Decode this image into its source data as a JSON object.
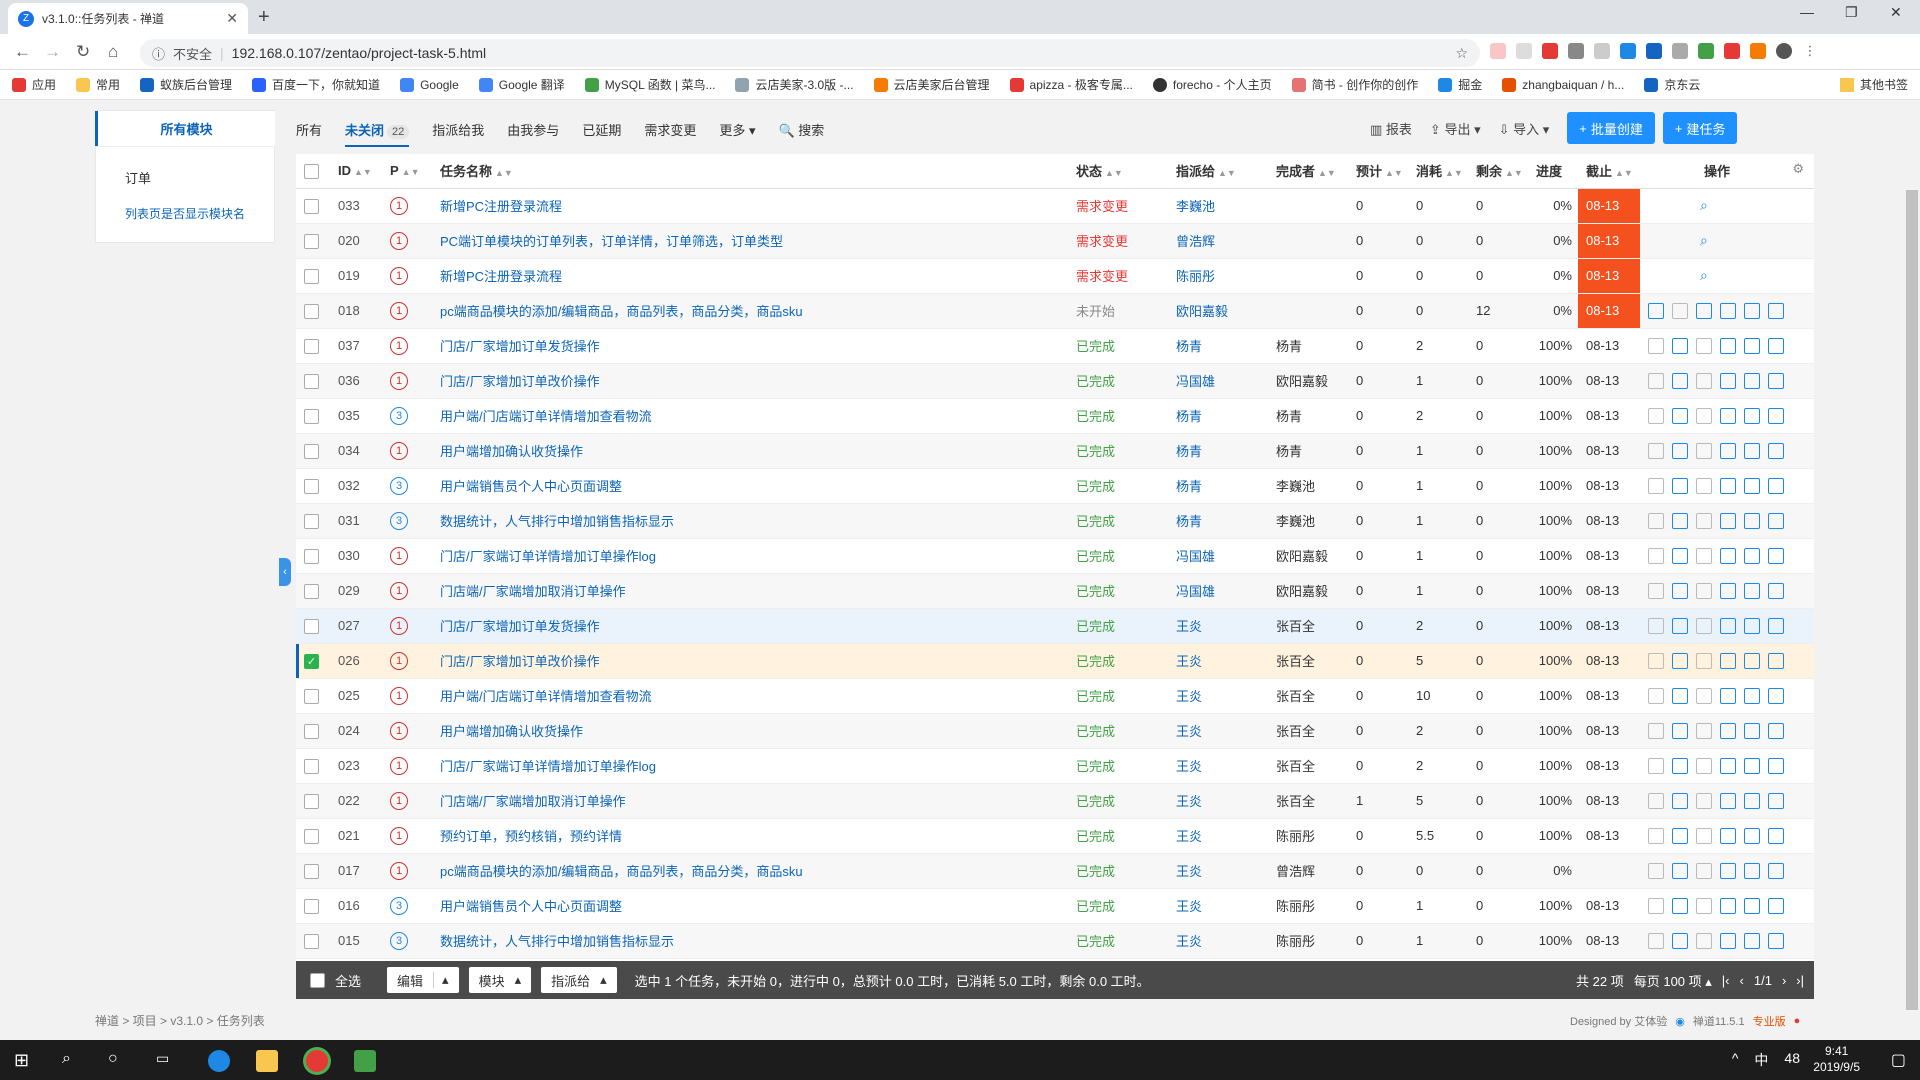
{
  "browser": {
    "tab_title": "v3.1.0::任务列表 - 禅道",
    "insecure": "不安全",
    "url": "192.168.0.107/zentao/project-task-5.html"
  },
  "bookmarks": [
    "应用",
    "常用",
    "蚁族后台管理",
    "百度一下，你就知道",
    "Google",
    "Google 翻译",
    "MySQL 函数 | 菜鸟...",
    "云店美家-3.0版 -...",
    "云店美家后台管理",
    "apizza - 极客专属...",
    "forecho - 个人主页",
    "简书 - 创作你的创作",
    "掘金",
    "zhangbaiquan / h...",
    "京东云"
  ],
  "bookmarks_other": "其他书签",
  "sidebar": {
    "title": "所有模块",
    "item": "订单",
    "link": "列表页是否显示模块名"
  },
  "filters": [
    {
      "label": "所有"
    },
    {
      "label": "未关闭",
      "count": "22"
    },
    {
      "label": "指派给我"
    },
    {
      "label": "由我参与"
    },
    {
      "label": "已延期"
    },
    {
      "label": "需求变更"
    },
    {
      "label": "更多 ▾"
    },
    {
      "label": "🔍 搜索"
    }
  ],
  "toolbar": {
    "report": "报表",
    "export": "导出",
    "import": "导入",
    "batch_create": "批量创建",
    "create": "建任务"
  },
  "columns": {
    "id": "ID",
    "p": "P",
    "name": "任务名称",
    "status": "状态",
    "assigned": "指派给",
    "finished": "完成者",
    "estimate": "预计",
    "consumed": "消耗",
    "left": "剩余",
    "progress": "进度",
    "deadline": "截止",
    "actions": "操作"
  },
  "rows": [
    {
      "id": "033",
      "p": "1",
      "name": "新增PC注册登录流程",
      "status": "需求变更",
      "st": "red",
      "assigned": "李巍池",
      "finished": "",
      "est": "0",
      "con": "0",
      "left": "0",
      "prog": "0%",
      "deadline": "08-13",
      "late": true,
      "mode": "search"
    },
    {
      "id": "020",
      "p": "1",
      "name": "PC端订单模块的订单列表，订单详情，订单筛选，订单类型",
      "status": "需求变更",
      "st": "red",
      "assigned": "曾浩辉",
      "finished": "",
      "est": "0",
      "con": "0",
      "left": "0",
      "prog": "0%",
      "deadline": "08-13",
      "late": true,
      "mode": "search"
    },
    {
      "id": "019",
      "p": "1",
      "name": "新增PC注册登录流程",
      "status": "需求变更",
      "st": "red",
      "assigned": "陈丽彤",
      "finished": "",
      "est": "0",
      "con": "0",
      "left": "0",
      "prog": "0%",
      "deadline": "08-13",
      "late": true,
      "mode": "search"
    },
    {
      "id": "018",
      "p": "1",
      "name": "pc端商品模块的添加/编辑商品，商品列表，商品分类，商品sku",
      "status": "未开始",
      "st": "grey",
      "assigned": "欧阳嘉毅",
      "finished": "",
      "est": "0",
      "con": "0",
      "left": "12",
      "prog": "0%",
      "deadline": "08-13",
      "late": true,
      "mode": "full"
    },
    {
      "id": "037",
      "p": "1",
      "name": "门店/厂家增加订单发货操作",
      "status": "已完成",
      "st": "green",
      "assigned": "杨青",
      "finished": "杨青",
      "est": "0",
      "con": "2",
      "left": "0",
      "prog": "100%",
      "deadline": "08-13",
      "mode": "done"
    },
    {
      "id": "036",
      "p": "1",
      "name": "门店/厂家增加订单改价操作",
      "status": "已完成",
      "st": "green",
      "assigned": "冯国雄",
      "finished": "欧阳嘉毅",
      "est": "0",
      "con": "1",
      "left": "0",
      "prog": "100%",
      "deadline": "08-13",
      "mode": "done"
    },
    {
      "id": "035",
      "p": "3",
      "name": "用户端/门店端订单详情增加查看物流",
      "status": "已完成",
      "st": "green",
      "assigned": "杨青",
      "finished": "杨青",
      "est": "0",
      "con": "2",
      "left": "0",
      "prog": "100%",
      "deadline": "08-13",
      "mode": "done"
    },
    {
      "id": "034",
      "p": "1",
      "name": "用户端增加确认收货操作",
      "status": "已完成",
      "st": "green",
      "assigned": "杨青",
      "finished": "杨青",
      "est": "0",
      "con": "1",
      "left": "0",
      "prog": "100%",
      "deadline": "08-13",
      "mode": "done"
    },
    {
      "id": "032",
      "p": "3",
      "name": "用户端销售员个人中心页面调整",
      "status": "已完成",
      "st": "green",
      "assigned": "杨青",
      "finished": "李巍池",
      "est": "0",
      "con": "1",
      "left": "0",
      "prog": "100%",
      "deadline": "08-13",
      "mode": "done"
    },
    {
      "id": "031",
      "p": "3",
      "name": "数据统计，人气排行中增加销售指标显示",
      "status": "已完成",
      "st": "green",
      "assigned": "杨青",
      "finished": "李巍池",
      "est": "0",
      "con": "1",
      "left": "0",
      "prog": "100%",
      "deadline": "08-13",
      "mode": "done"
    },
    {
      "id": "030",
      "p": "1",
      "name": "门店/厂家端订单详情增加订单操作log",
      "status": "已完成",
      "st": "green",
      "assigned": "冯国雄",
      "finished": "欧阳嘉毅",
      "est": "0",
      "con": "1",
      "left": "0",
      "prog": "100%",
      "deadline": "08-13",
      "mode": "done"
    },
    {
      "id": "029",
      "p": "1",
      "name": "门店端/厂家端增加取消订单操作",
      "status": "已完成",
      "st": "green",
      "assigned": "冯国雄",
      "finished": "欧阳嘉毅",
      "est": "0",
      "con": "1",
      "left": "0",
      "prog": "100%",
      "deadline": "08-13",
      "mode": "done"
    },
    {
      "id": "027",
      "p": "1",
      "name": "门店/厂家增加订单发货操作",
      "status": "已完成",
      "st": "green",
      "assigned": "王炎",
      "finished": "张百全",
      "est": "0",
      "con": "2",
      "left": "0",
      "prog": "100%",
      "deadline": "08-13",
      "mode": "done",
      "hover": true
    },
    {
      "id": "026",
      "p": "1",
      "name": "门店/厂家增加订单改价操作",
      "status": "已完成",
      "st": "green",
      "assigned": "王炎",
      "finished": "张百全",
      "est": "0",
      "con": "5",
      "left": "0",
      "prog": "100%",
      "deadline": "08-13",
      "mode": "done",
      "selected": true
    },
    {
      "id": "025",
      "p": "1",
      "name": "用户端/门店端订单详情增加查看物流",
      "status": "已完成",
      "st": "green",
      "assigned": "王炎",
      "finished": "张百全",
      "est": "0",
      "con": "10",
      "left": "0",
      "prog": "100%",
      "deadline": "08-13",
      "mode": "done"
    },
    {
      "id": "024",
      "p": "1",
      "name": "用户端增加确认收货操作",
      "status": "已完成",
      "st": "green",
      "assigned": "王炎",
      "finished": "张百全",
      "est": "0",
      "con": "2",
      "left": "0",
      "prog": "100%",
      "deadline": "08-13",
      "mode": "done"
    },
    {
      "id": "023",
      "p": "1",
      "name": "门店/厂家端订单详情增加订单操作log",
      "status": "已完成",
      "st": "green",
      "assigned": "王炎",
      "finished": "张百全",
      "est": "0",
      "con": "2",
      "left": "0",
      "prog": "100%",
      "deadline": "08-13",
      "mode": "done"
    },
    {
      "id": "022",
      "p": "1",
      "name": "门店端/厂家端增加取消订单操作",
      "status": "已完成",
      "st": "green",
      "assigned": "王炎",
      "finished": "张百全",
      "est": "1",
      "con": "5",
      "left": "0",
      "prog": "100%",
      "deadline": "08-13",
      "mode": "done"
    },
    {
      "id": "021",
      "p": "1",
      "name": "预约订单，预约核销，预约详情",
      "status": "已完成",
      "st": "green",
      "assigned": "王炎",
      "finished": "陈丽彤",
      "est": "0",
      "con": "5.5",
      "left": "0",
      "prog": "100%",
      "deadline": "08-13",
      "mode": "done"
    },
    {
      "id": "017",
      "p": "1",
      "name": "pc端商品模块的添加/编辑商品，商品列表，商品分类，商品sku",
      "status": "已完成",
      "st": "green",
      "assigned": "王炎",
      "finished": "曾浩辉",
      "est": "0",
      "con": "0",
      "left": "0",
      "prog": "0%",
      "deadline": "",
      "mode": "done"
    },
    {
      "id": "016",
      "p": "3",
      "name": "用户端销售员个人中心页面调整",
      "status": "已完成",
      "st": "green",
      "assigned": "王炎",
      "finished": "陈丽彤",
      "est": "0",
      "con": "1",
      "left": "0",
      "prog": "100%",
      "deadline": "08-13",
      "mode": "done"
    },
    {
      "id": "015",
      "p": "3",
      "name": "数据统计，人气排行中增加销售指标显示",
      "status": "已完成",
      "st": "green",
      "assigned": "王炎",
      "finished": "陈丽彤",
      "est": "0",
      "con": "1",
      "left": "0",
      "prog": "100%",
      "deadline": "08-13",
      "mode": "done"
    }
  ],
  "footer": {
    "select_all": "全选",
    "edit": "编辑",
    "module": "模块",
    "assign": "指派给",
    "summary": "选中 1 个任务，未开始 0，进行中 0，总预计 0.0 工时，已消耗 5.0 工时，剩余 0.0 工时。",
    "total": "共 22 项",
    "per_page": "每页 100 项",
    "page": "1/1"
  },
  "breadcrumb": "禅道 > 项目 > v3.1.0 > 任务列表",
  "designed": "Designed by 艾体验",
  "version": "禅道11.5.1",
  "edition": "专业版",
  "clock": {
    "time": "9:41",
    "date": "2019/9/5"
  },
  "tray": {
    "ime": "中",
    "num": "48"
  }
}
